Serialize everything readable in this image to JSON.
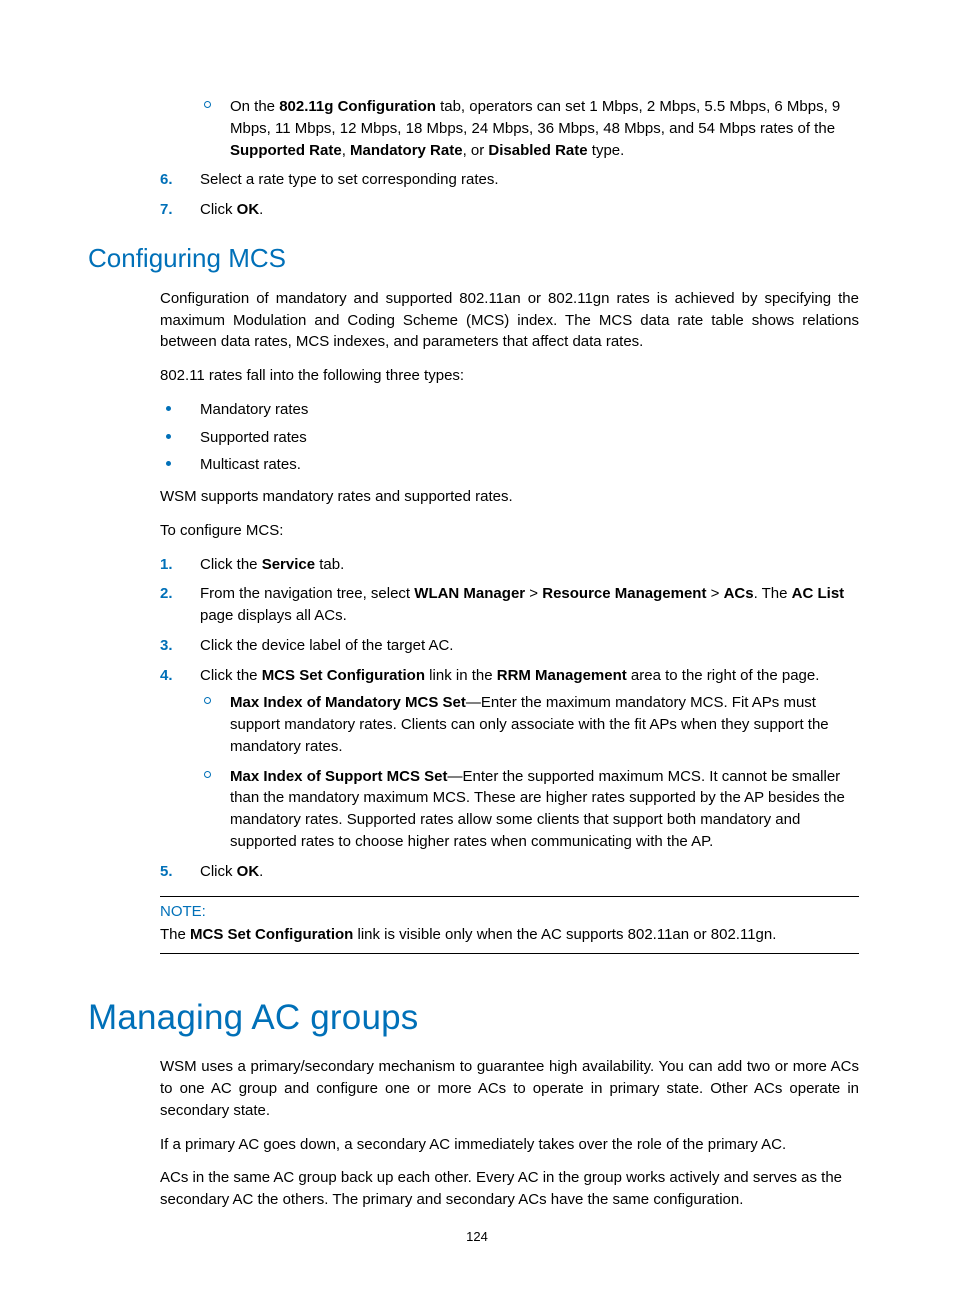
{
  "intro_subitem": {
    "prefix": "On the ",
    "bold1": "802.11g Configuration",
    "mid1": " tab, operators can set 1 Mbps, 2 Mbps, 5.5 Mbps, 6 Mbps, 9 Mbps, 11 Mbps, 12 Mbps, 18 Mbps, 24 Mbps, 36 Mbps, 48 Mbps, and 54 Mbps rates of the ",
    "bold2": "Supported Rate",
    "comma1": ", ",
    "bold3": "Mandatory Rate",
    "comma2": ", or ",
    "bold4": "Disabled Rate",
    "suffix": " type."
  },
  "step6": {
    "marker": "6.",
    "text": "Select a rate type to set corresponding rates."
  },
  "step7": {
    "marker": "7.",
    "prefix": "Click ",
    "bold": "OK",
    "suffix": "."
  },
  "h_mcs": "Configuring MCS",
  "mcs_p1": "Configuration of mandatory and supported 802.11an or 802.11gn rates is achieved by specifying the maximum Modulation and Coding Scheme (MCS) index. The MCS data rate table shows relations between data rates, MCS indexes, and parameters that affect data rates.",
  "mcs_p2": "802.11 rates fall into the following three types:",
  "mcs_bullets": [
    "Mandatory rates",
    "Supported rates",
    "Multicast rates."
  ],
  "mcs_p3": "WSM supports mandatory rates and supported rates.",
  "mcs_p4": "To configure MCS:",
  "mcs_steps": {
    "s1": {
      "marker": "1.",
      "prefix": "Click the ",
      "b1": "Service",
      "suffix": " tab."
    },
    "s2": {
      "marker": "2.",
      "t1": "From the navigation tree, select ",
      "b1": "WLAN Manager",
      "gt1": " > ",
      "b2": "Resource Management",
      "gt2": " > ",
      "b3": "ACs",
      "t2": ". The ",
      "b4": "AC List",
      "t3": " page displays all ACs."
    },
    "s3": {
      "marker": "3.",
      "text": "Click the device label of the target AC."
    },
    "s4": {
      "marker": "4.",
      "t1": "Click the ",
      "b1": "MCS Set Configuration",
      "t2": " link in the ",
      "b2": "RRM Management",
      "t3": " area to the right of the page."
    },
    "s4_sub1": {
      "b1": "Max Index of Mandatory MCS Set",
      "t1": "—Enter the maximum mandatory MCS. Fit APs must support mandatory rates. Clients can only associate with the fit APs when they support the mandatory rates."
    },
    "s4_sub2": {
      "b1": "Max Index of Support MCS Set",
      "t1": "—Enter the supported maximum MCS. It cannot be smaller than the mandatory maximum MCS. These are higher rates supported by the AP besides the mandatory rates. Supported rates allow some clients that support both mandatory and supported rates to choose higher rates when communicating with the AP."
    },
    "s5": {
      "marker": "5.",
      "prefix": "Click ",
      "b1": "OK",
      "suffix": "."
    }
  },
  "note": {
    "label": "NOTE:",
    "t1": "The ",
    "b1": "MCS Set Configuration",
    "t2": " link is visible only when the AC supports 802.11an or 802.11gn."
  },
  "h_ac": "Managing AC groups",
  "ac_p1": "WSM uses a primary/secondary mechanism to guarantee high availability. You can add two or more ACs to one AC group and configure one or more ACs to operate in primary state. Other ACs operate in secondary state.",
  "ac_p2": "If a primary AC goes down, a secondary AC immediately takes over the role of the primary AC.",
  "ac_p3": "ACs in the same AC group back up each other. Every AC in the group works actively and serves as the secondary AC the others. The primary and secondary ACs have the same configuration.",
  "page_number": "124"
}
